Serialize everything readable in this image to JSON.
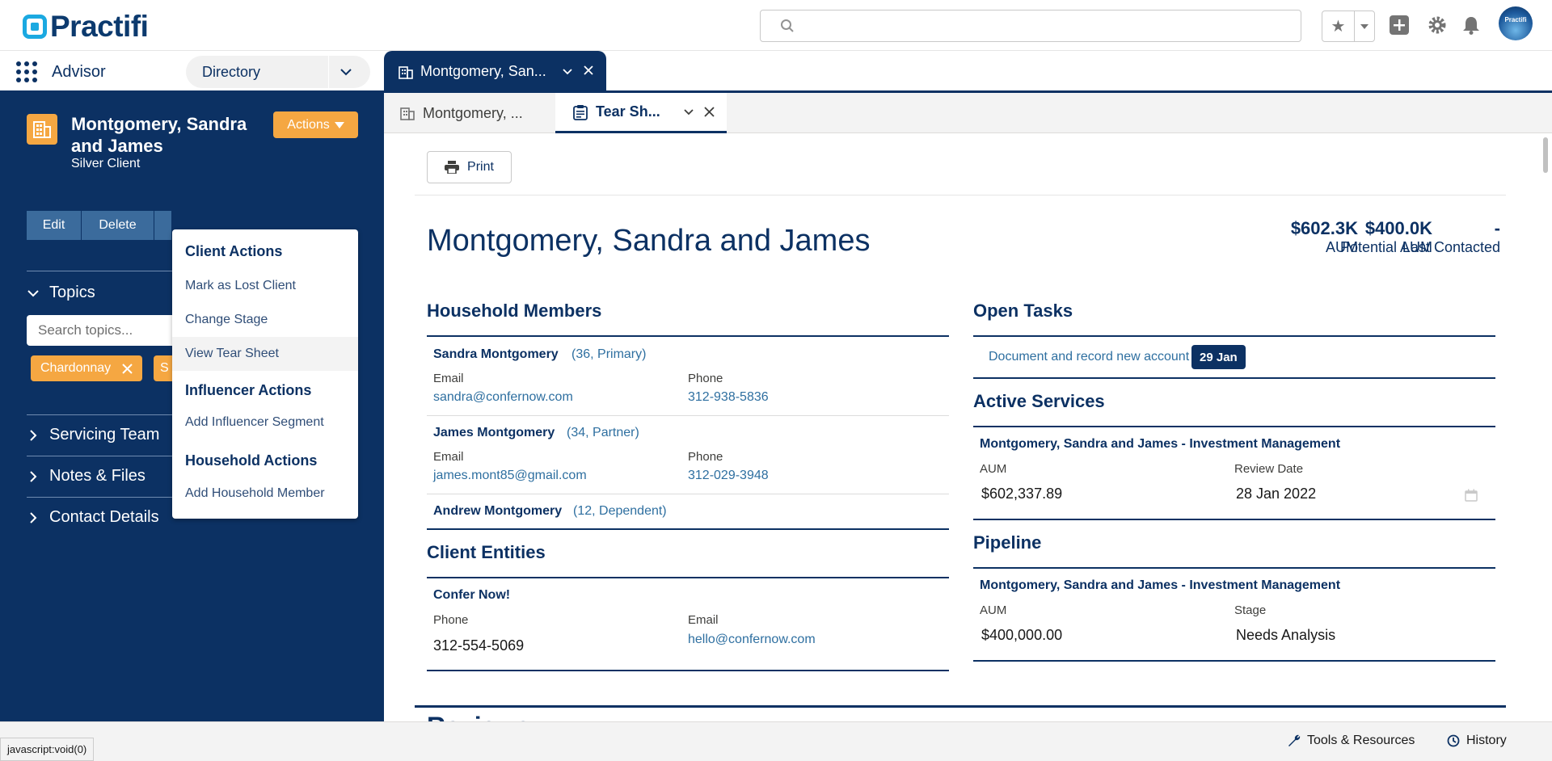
{
  "brand": {
    "name": "Practifi"
  },
  "header": {
    "search_placeholder": "",
    "avatar_text": "Practifi"
  },
  "nav": {
    "app_name": "Advisor",
    "directory_select": "Directory",
    "workspace_tab": "Montgomery, San..."
  },
  "subtabs": [
    {
      "label": "Montgomery, ..."
    },
    {
      "label": "Tear Sh..."
    }
  ],
  "sidebar": {
    "account_name": "Montgomery, Sandra and James",
    "account_type": "Silver Client",
    "actions_label": "Actions",
    "buttons": [
      "Edit",
      "Delete"
    ],
    "topics_label": "Topics",
    "topic_search_placeholder": "Search topics...",
    "chips": [
      "Chardonnay",
      "S"
    ],
    "sections": [
      "Servicing Team",
      "Notes & Files",
      "Contact Details"
    ]
  },
  "actions_menu": {
    "client_actions": "Client Actions",
    "mark_lost": "Mark as Lost Client",
    "change_stage": "Change Stage",
    "view_tear_sheet": "View Tear Sheet",
    "influencer_actions": "Influencer Actions",
    "add_influencer_segment": "Add Influencer Segment",
    "household_actions": "Household Actions",
    "add_household_member": "Add Household Member"
  },
  "tear_sheet": {
    "print_label": "Print",
    "title": "Montgomery, Sandra and James",
    "metrics": [
      {
        "value": "$602.3K",
        "label": "AUM"
      },
      {
        "value": "$400.0K",
        "label": "Potential AUM"
      },
      {
        "value": "-",
        "label": "Last Contacted"
      }
    ],
    "household": {
      "title": "Household Members",
      "members": [
        {
          "name": "Sandra Montgomery",
          "meta": "(36, Primary)",
          "email_label": "Email",
          "email": "sandra@confernow.com",
          "phone_label": "Phone",
          "phone": "312-938-5836"
        },
        {
          "name": "James Montgomery",
          "meta": "(34, Partner)",
          "email_label": "Email",
          "email": "james.mont85@gmail.com",
          "phone_label": "Phone",
          "phone": "312-029-3948"
        },
        {
          "name": "Andrew Montgomery",
          "meta": "(12, Dependent)"
        }
      ]
    },
    "entities": {
      "title": "Client Entities",
      "name": "Confer Now!",
      "phone_label": "Phone",
      "phone": "312-554-5069",
      "email_label": "Email",
      "email": "hello@confernow.com"
    },
    "open_tasks": {
      "title": "Open Tasks",
      "task": "Document and record new account",
      "date": "29 Jan"
    },
    "active_services": {
      "title": "Active Services",
      "name": "Montgomery, Sandra and James - Investment Management",
      "aum_label": "AUM",
      "aum": "$602,337.89",
      "review_label": "Review Date",
      "review_date": "28 Jan 2022"
    },
    "pipeline": {
      "title": "Pipeline",
      "name": "Montgomery, Sandra and James - Investment Management",
      "aum_label": "AUM",
      "aum": "$400,000.00",
      "stage_label": "Stage",
      "stage": "Needs Analysis"
    },
    "cut_heading": "Reviews"
  },
  "footer": {
    "tools": "Tools & Resources",
    "history": "History",
    "status_url": "javascript:void(0)"
  },
  "colors": {
    "navy": "#0c3163",
    "orange": "#f5a742",
    "link": "#2e6fa0"
  }
}
